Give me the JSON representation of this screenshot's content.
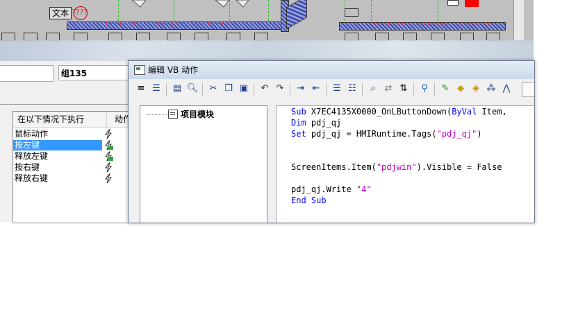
{
  "hmi": {
    "text_label": "文本",
    "question_marks": "????",
    "belt_marks": "+++++++"
  },
  "props": {
    "object_name": "组135"
  },
  "events": {
    "header_condition": "在以下情况下执行",
    "header_action": "动作",
    "rows": [
      {
        "label": "鼠标动作",
        "selected": false,
        "icon": "lightning-icon"
      },
      {
        "label": "按左键",
        "selected": true,
        "icon": "vb-script-icon"
      },
      {
        "label": "释放左键",
        "selected": false,
        "icon": "vb-script-icon"
      },
      {
        "label": "按右键",
        "selected": false,
        "icon": "lightning-icon"
      },
      {
        "label": "释放右键",
        "selected": false,
        "icon": "lightning-icon"
      }
    ]
  },
  "vb_editor": {
    "title": "编辑 VB 动作",
    "tree_root": "项目模块",
    "code": {
      "line1_kw": "Sub",
      "line1_name": " X7EC4135X0000_OnLButtonDown(",
      "line1_kw2": "ByVal",
      "line1_rest": " Item,",
      "line2_kw": "Dim",
      "line2_rest": " pdj_qj",
      "line3_kw": "Set",
      "line3_mid": " pdj_qj = HMIRuntime.Tags(",
      "line3_str": "\"pdj_qj\"",
      "line3_end": ")",
      "line4_pre": "ScreenItems.Item(",
      "line4_str": "\"pdjwin\"",
      "line4_rest": ").Visible = False",
      "line5_pre": "pdj_qj.Write ",
      "line5_str": "\"4\"",
      "line6_kw": "End Sub"
    }
  },
  "colors": {
    "keyword": "#0000ff",
    "string": "#c000c0",
    "selection": "#3399ff"
  }
}
